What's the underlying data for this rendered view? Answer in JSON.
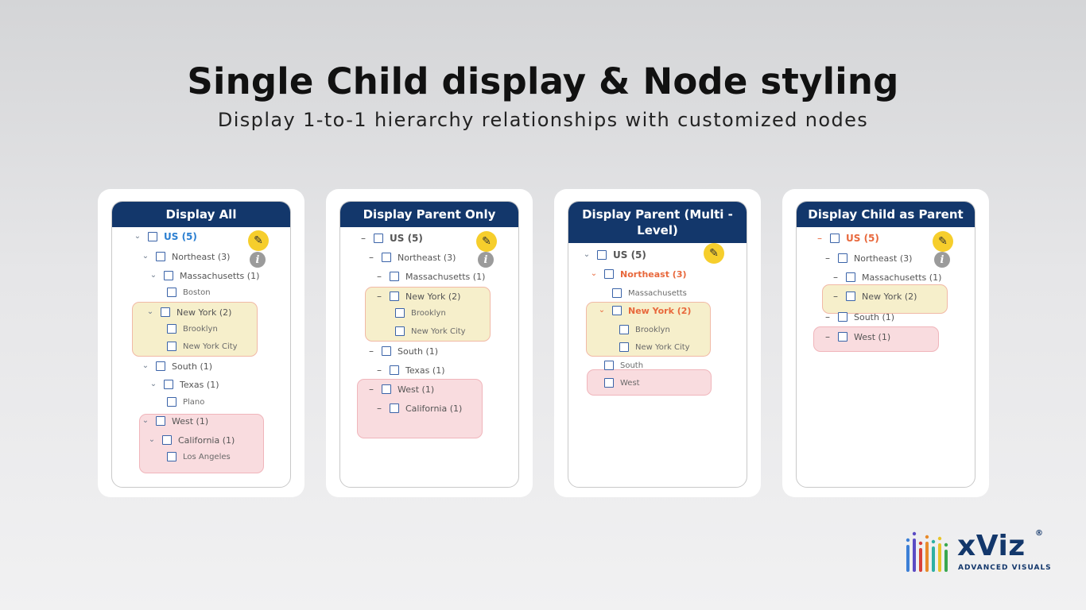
{
  "header": {
    "title": "Single Child display & Node styling",
    "subtitle": "Display 1-to-1 hierarchy relationships with customized nodes"
  },
  "icons": {
    "pencil": "pencil-icon",
    "info": "info-icon",
    "expand": "chevron-down-icon",
    "collapse": "minus-icon"
  },
  "colors": {
    "header_bg": "#13376b",
    "highlight_yellow": "#f6efcb",
    "highlight_red": "#f9dcdf",
    "accent_orange": "#e8683c",
    "accent_blue": "#2b7fd1",
    "edit_button": "#f6ce2c"
  },
  "glyphs": {
    "chevron": "⌄",
    "dash": "–",
    "pencil": "✎",
    "info": "i"
  },
  "panels": [
    {
      "title": "Display All",
      "nodes": [
        "US (5)",
        "Northeast (3)",
        "Massachusetts (1)",
        "Boston",
        "New York (2)",
        "Brooklyn",
        "New York City",
        "South (1)",
        "Texas (1)",
        "Plano",
        "West (1)",
        "California (1)",
        "Los Angeles"
      ]
    },
    {
      "title": "Display Parent Only",
      "nodes": [
        "US (5)",
        "Northeast (3)",
        "Massachusetts (1)",
        "New York (2)",
        "Brooklyn",
        "New York City",
        "South (1)",
        "Texas (1)",
        "West (1)",
        "California (1)"
      ]
    },
    {
      "title": "Display Parent (Multi - Level)",
      "nodes": [
        "US (5)",
        "Northeast (3)",
        "Massachusetts",
        "New York (2)",
        "Brooklyn",
        "New York City",
        "South",
        "West"
      ]
    },
    {
      "title": "Display Child as Parent",
      "nodes": [
        "US (5)",
        "Northeast (3)",
        "Massachusetts (1)",
        "New York (2)",
        "South (1)",
        "West (1)"
      ]
    }
  ],
  "logo": {
    "name": "xViz",
    "registered": "®",
    "tagline": "ADVANCED VISUALS"
  }
}
